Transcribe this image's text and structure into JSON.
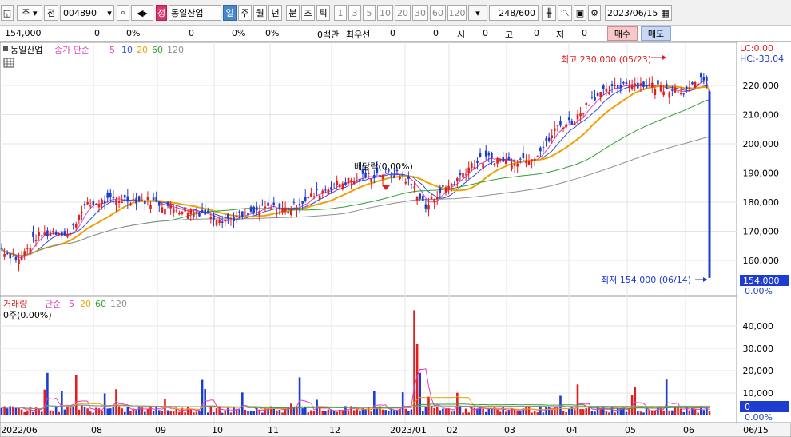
{
  "toolbar": {
    "market": "주",
    "prev": "전",
    "code": "004890",
    "badge": "정",
    "name": "동일산업",
    "periods": [
      "일",
      "주",
      "월",
      "년",
      "분",
      "초",
      "틱"
    ],
    "intervals": [
      "1",
      "3",
      "5",
      "10",
      "20",
      "30",
      "60",
      "120"
    ],
    "count": "248",
    "count_max": "/600",
    "date": "2023/06/15"
  },
  "infobar": {
    "price": "154,000",
    "v1": "0",
    "p1": "0%",
    "v2": "0",
    "p2": "0%",
    "p3": "0%",
    "amount": "0백만",
    "best": "최우선",
    "b1": "0",
    "b2": "0",
    "open_label": "시",
    "open": "0",
    "high_label": "고",
    "high": "0",
    "low_label": "저",
    "low": "0",
    "buy": "매수",
    "sell": "매도"
  },
  "price_panel": {
    "name": "동일산업",
    "indicator": "종가 단순",
    "ma": [
      "5",
      "10",
      "20",
      "60",
      "120"
    ],
    "lc": "LC:0.00",
    "hc": "HC:-33.04",
    "high_note": "최고 230,000 (05/23)",
    "low_note": "최저 154,000 (06/14)",
    "div_note": "배당락(0.00%)",
    "last_price": "154,000",
    "last_pct": "0.00%",
    "y_ticks": [
      "220,000",
      "210,000",
      "200,000",
      "190,000",
      "180,000",
      "170,000",
      "160,000"
    ]
  },
  "volume_panel": {
    "title": "거래량",
    "indicator": "단순",
    "ma": [
      "5",
      "20",
      "60",
      "120"
    ],
    "sub": "0주(0.00%)",
    "last": "0",
    "last_pct": "0.00%",
    "y_ticks": [
      "40,000",
      "30,000",
      "20,000",
      "10,000"
    ]
  },
  "x_axis": [
    "2022/06",
    "08",
    "09",
    "10",
    "11",
    "12",
    "2023/01",
    "02",
    "03",
    "04",
    "05",
    "06",
    "06/15"
  ],
  "colors": {
    "up": "#e02020",
    "down": "#1e3cd0",
    "ma5": "#e040c0",
    "ma10": "#3050e0",
    "ma20": "#f0a000",
    "ma60": "#30a030",
    "ma120": "#909090"
  },
  "chart_data": {
    "type": "candlestick",
    "price_range": [
      154000,
      230000
    ],
    "high": {
      "value": 230000,
      "date": "05/23"
    },
    "low": {
      "value": 154000,
      "date": "06/14"
    },
    "last_close": 154000,
    "volume_max_axis": 40000
  }
}
